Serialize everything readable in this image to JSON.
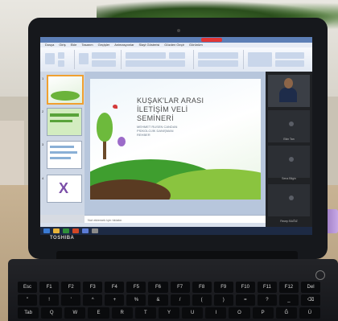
{
  "laptop": {
    "brand": "TOSHIBA"
  },
  "window": {
    "tabs": [
      "Dosya",
      "Giriş",
      "Ekle",
      "Tasarım",
      "Geçişler",
      "Animasyonlar",
      "Slayt Gösterisi",
      "Gözden Geçir",
      "Görünüm"
    ],
    "thumb_numbers": [
      "1",
      "2",
      "3",
      "4"
    ]
  },
  "slide": {
    "title_lines": [
      "KUŞAK'LAR ARASI",
      "İLETİŞİM VELİ",
      "SEMİNERİ"
    ],
    "subtitle_lines": [
      "MEHMET RUSEN CANDAN",
      "PSİKOLOJİK DANIŞMAN",
      "REHBER"
    ]
  },
  "notes": {
    "placeholder": "Not eklemek için tıklatın"
  },
  "meeting": {
    "participants": [
      "",
      "Ekin Tan",
      "Sena Bilgin",
      "Recep BAĞIZ"
    ]
  },
  "keyboard": {
    "row1": [
      "Esc",
      "F1",
      "F2",
      "F3",
      "F4",
      "F5",
      "F6",
      "F7",
      "F8",
      "F9",
      "F10",
      "F11",
      "F12",
      "Del"
    ],
    "row2": [
      "\"",
      "!",
      "'",
      "^",
      "+",
      "%",
      "&",
      "/",
      "(",
      ")",
      "=",
      "?",
      "_",
      "⌫"
    ],
    "row3": [
      "Tab",
      "Q",
      "W",
      "E",
      "R",
      "T",
      "Y",
      "U",
      "I",
      "O",
      "P",
      "Ğ",
      "Ü"
    ]
  }
}
